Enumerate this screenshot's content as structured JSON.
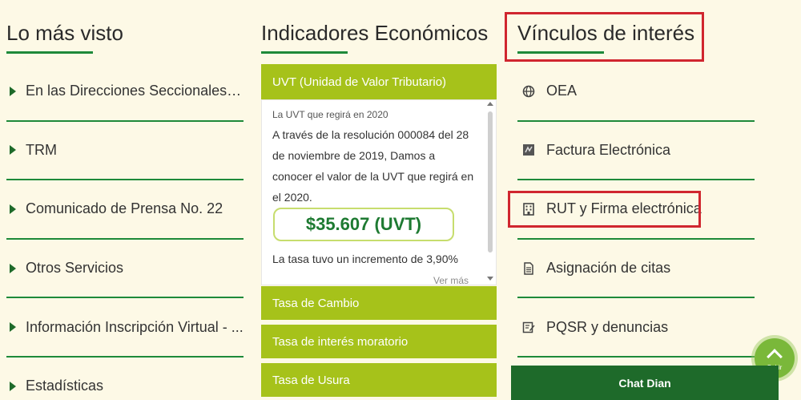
{
  "left": {
    "title": "Lo más visto",
    "items": [
      {
        "label": "En las Direcciones Seccionales d..."
      },
      {
        "label": "TRM"
      },
      {
        "label": "Comunicado de Prensa No. 22"
      },
      {
        "label": "Otros Servicios"
      },
      {
        "label": "Información Inscripción Virtual - ..."
      },
      {
        "label": "Estadísticas"
      }
    ]
  },
  "middle": {
    "title": "Indicadores Económicos",
    "panels": [
      {
        "label": "UVT (Unidad de Valor Tributario)"
      },
      {
        "label": "Tasa de Cambio"
      },
      {
        "label": "Tasa de interés moratorio"
      },
      {
        "label": "Tasa de Usura"
      }
    ],
    "uvt": {
      "subtitle": "La UVT que regirá en 2020",
      "description": "A través de la resolución 000084 del 28 de noviembre de 2019, Damos a conocer el valor de la UVT que regirá en el 2020.",
      "value": "$35.607 (UVT)",
      "rate_note": "La tasa tuvo un incremento de 3,90%",
      "more_link": "Ver más"
    }
  },
  "right": {
    "title": "Vínculos de interés",
    "items": [
      {
        "label": "OEA",
        "icon": "globe-icon"
      },
      {
        "label": "Factura Electrónica",
        "icon": "invoice-icon"
      },
      {
        "label": "RUT y Firma electrónica",
        "icon": "building-icon"
      },
      {
        "label": "Asignación de citas",
        "icon": "document-icon"
      },
      {
        "label": "PQSR y denuncias",
        "icon": "form-edit-icon"
      }
    ]
  },
  "chat": {
    "label": "Chat Dian"
  },
  "scroll_up": {
    "label": "Subir"
  },
  "colors": {
    "background": "#fdf9e6",
    "accent_green": "#1e8a3a",
    "panel_green": "#a6c21a",
    "chat_green": "#1e6a2a",
    "highlight_red": "#d0262f"
  }
}
